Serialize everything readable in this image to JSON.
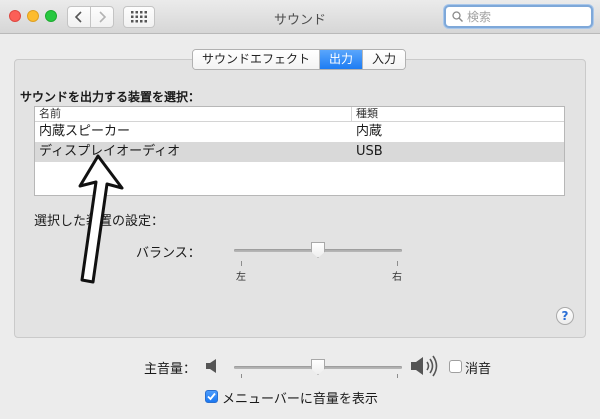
{
  "window": {
    "title": "サウンド"
  },
  "search": {
    "placeholder": "検索"
  },
  "tabs": [
    {
      "label": "サウンドエフェクト",
      "active": false
    },
    {
      "label": "出力",
      "active": true
    },
    {
      "label": "入力",
      "active": false
    }
  ],
  "output": {
    "section_label": "サウンドを出力する装置を選択：",
    "columns": [
      "名前",
      "種類"
    ],
    "rows": [
      {
        "name": "内蔵スピーカー",
        "type": "内蔵",
        "selected": false
      },
      {
        "name": "ディスプレイオーディオ",
        "type": "USB",
        "selected": true
      }
    ],
    "settings_label": "選択した装置の設定：",
    "balance": {
      "label": "バランス：",
      "left": "左",
      "right": "右",
      "value": 0.5
    }
  },
  "volume": {
    "label": "主音量：",
    "value": 0.5,
    "mute_label": "消音",
    "mute_checked": false
  },
  "menubar_option": {
    "label": "メニューバーに音量を表示",
    "checked": true
  },
  "help": {
    "label": "?"
  },
  "colors": {
    "accent": "#1d7cf3",
    "selection_row": "#d9d9d9"
  }
}
